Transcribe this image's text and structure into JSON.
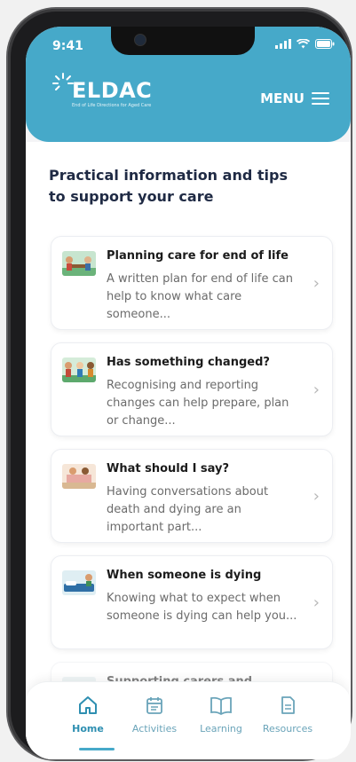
{
  "status": {
    "time": "9:41"
  },
  "header": {
    "logo_text": "ELDAC",
    "logo_tagline": "End of Life Directions for Aged Care",
    "menu_label": "MENU"
  },
  "page": {
    "title": "Practical information and tips to support your care"
  },
  "cards": [
    {
      "title": "Planning care for end of life",
      "desc": "A written plan for end of life can help to know what care someone..."
    },
    {
      "title": "Has something changed?",
      "desc": "Recognising and reporting changes can help prepare, plan or change..."
    },
    {
      "title": "What should I say?",
      "desc": "Having conversations about death and dying are an important part..."
    },
    {
      "title": "When someone is dying",
      "desc": "Knowing what to expect when someone is dying can help you..."
    },
    {
      "title": "Supporting carers and",
      "desc": ""
    }
  ],
  "tabs": [
    {
      "label": "Home",
      "icon": "home-icon",
      "active": true
    },
    {
      "label": "Activities",
      "icon": "calendar-icon",
      "active": false
    },
    {
      "label": "Learning",
      "icon": "book-icon",
      "active": false
    },
    {
      "label": "Resources",
      "icon": "document-icon",
      "active": false
    }
  ],
  "colors": {
    "brand": "#46a9c9",
    "title": "#1f2a44",
    "tab_active": "#2e8fb1"
  }
}
